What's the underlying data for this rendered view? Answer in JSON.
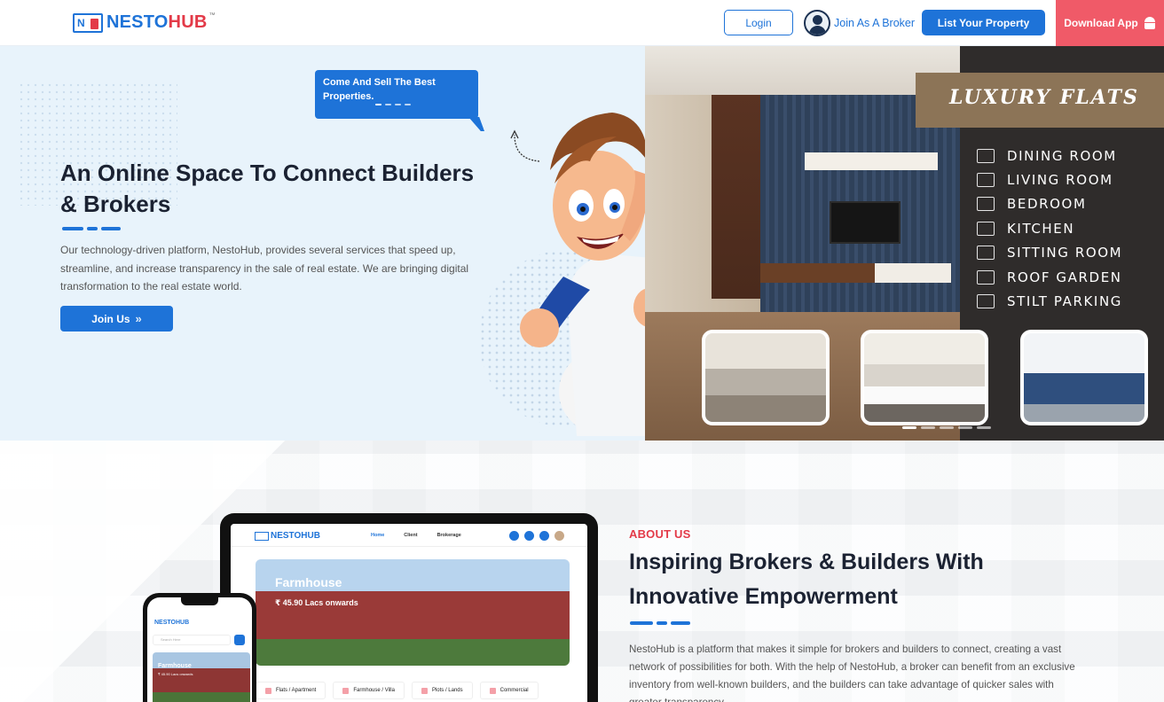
{
  "header": {
    "logo_mark": "N",
    "logo_part1": "NESTO",
    "logo_part2": "HUB",
    "logo_tm": "™",
    "login_label": "Login",
    "broker_label": "Join As A Broker",
    "list_property_label": "List Your Property",
    "download_label": "Download App"
  },
  "hero": {
    "bubble_text": "Come And Sell The Best Properties.",
    "title": "An Online Space To Connect Builders & Brokers",
    "description": "Our technology-driven platform, NestoHub, provides several services that speed up, streamline, and increase transparency in the sale of real estate. We are bringing digital transformation to the real estate world.",
    "join_label": "Join Us",
    "join_icon": "»",
    "banner": {
      "title": "LUXURY FLATS",
      "amenities": [
        "DINING ROOM",
        "LIVING ROOM",
        "BEDROOM",
        "KITCHEN",
        "SITTING ROOM",
        "ROOF GARDEN",
        "STILT PARKING"
      ]
    }
  },
  "mockup": {
    "laptop_logo": "NESTOHUB",
    "laptop_nav": [
      "Home",
      "Client",
      "Brokerage"
    ],
    "laptop_hero_title": "Farmhouse",
    "laptop_hero_sub": "₹ 45.90 Lacs onwards",
    "laptop_categories": [
      "Flats / Apartment",
      "Farmhouse / Villa",
      "Plots / Lands",
      "Commercial"
    ],
    "phone_logo": "NESTOHUB",
    "phone_search_placeholder": "Search Here",
    "phone_hero_title": "Farmhouse",
    "phone_hero_sub": "₹ 45.90 Lacs onwards"
  },
  "about": {
    "label": "ABOUT US",
    "title": "Inspiring Brokers & Builders With Innovative Empowerment",
    "description": "NestoHub is a platform that makes it simple for brokers and builders to connect, creating a vast network of possibilities for both. With the help of NestoHub, a broker can benefit from an exclusive inventory from well-known builders, and the builders can take advantage of quicker sales with greater transparency."
  },
  "colors": {
    "primary": "#1e73d8",
    "accent": "#e33a48",
    "download_bg": "#f05a68",
    "hero_bg": "#e8f3fb"
  },
  "icons": [
    "logo-icon",
    "broker-avatar-icon",
    "android-icon",
    "double-chevron-right-icon",
    "curved-arrow-icon",
    "checkbox-icon"
  ]
}
